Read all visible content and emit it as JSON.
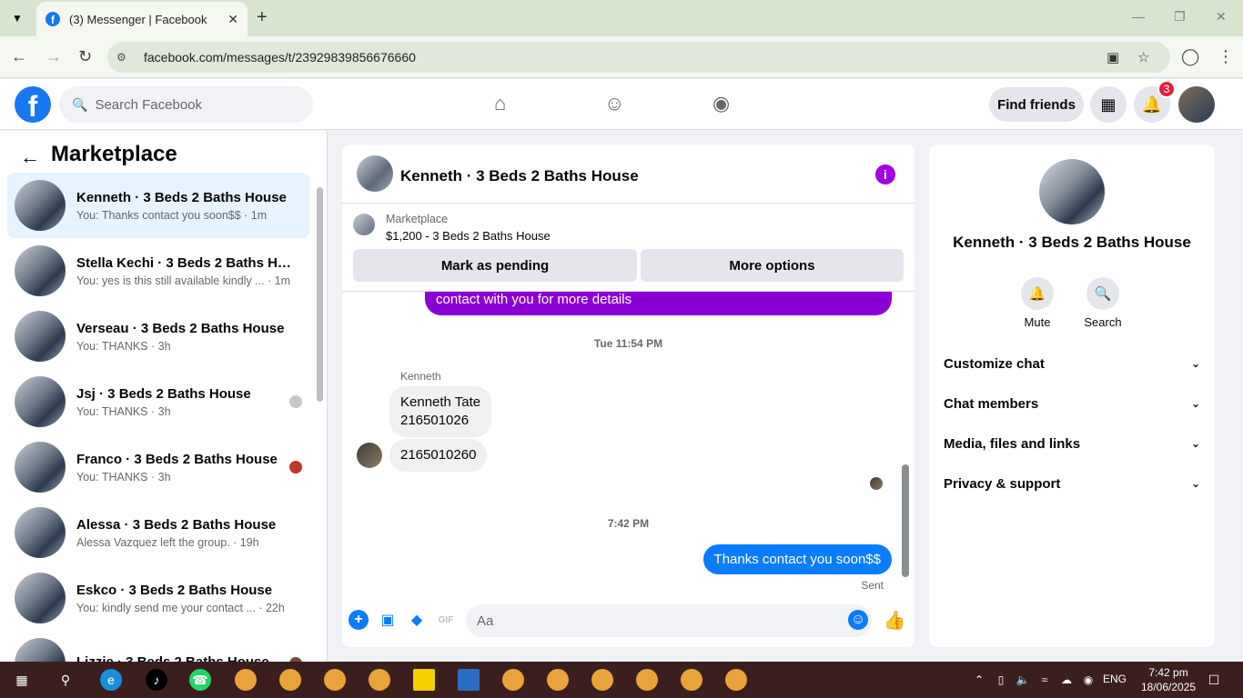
{
  "browser": {
    "tab_title": "(3) Messenger | Facebook",
    "url": "facebook.com/messages/t/23929839856676660",
    "colors": {
      "tabbar": "#d8e4d0",
      "active_tab": "#f4f8f1"
    }
  },
  "fb_header": {
    "search_placeholder": "Search Facebook",
    "find_friends": "Find friends",
    "notification_count": "3",
    "brand_color": "#1877f2"
  },
  "sidebar": {
    "title": "Marketplace",
    "conversations": [
      {
        "name": "Kenneth · 3 Beds 2 Baths House",
        "preview": "You: Thanks contact you soon$$ · 1m",
        "active": true
      },
      {
        "name": "Stella Kechi · 3 Beds 2 Baths Ho...",
        "preview": "You: yes is this still available kindly ... · 1m"
      },
      {
        "name": "Verseau · 3 Beds 2 Baths House",
        "preview": "You: THANKS · 3h"
      },
      {
        "name": "Jsj · 3 Beds 2 Baths House",
        "preview": "You: THANKS · 3h"
      },
      {
        "name": "Franco · 3 Beds 2 Baths House",
        "preview": "You: THANKS · 3h"
      },
      {
        "name": "Alessa · 3 Beds 2 Baths House",
        "preview": "Alessa Vazquez left the group. · 19h"
      },
      {
        "name": "Eskco · 3 Beds 2 Baths House",
        "preview": "You: kindly send me your contact ... · 22h"
      },
      {
        "name": "Lizzie · 3 Beds 2 Baths House",
        "preview": ""
      }
    ]
  },
  "chat": {
    "title": "Kenneth · 3 Beds 2 Baths House",
    "marketplace_label": "Marketplace",
    "listing": "$1,200 - 3 Beds 2 Baths House",
    "mark_pending": "Mark as pending",
    "more_options": "More options",
    "msg_partial": "contact with you for more details",
    "ts1": "Tue 11:54 PM",
    "sender": "Kenneth",
    "in_msg1_line1": "Kenneth Tate",
    "in_msg1_line2": "216501026",
    "in_msg2": "2165010260",
    "ts2": "7:42 PM",
    "out_msg": "Thanks contact you soon$$",
    "sent_label": "Sent",
    "composer_placeholder": "Aa",
    "accent": "#8a00d4",
    "bubble_blue": "#0a7cff"
  },
  "info_panel": {
    "name": "Kenneth · 3 Beds 2 Baths House",
    "mute": "Mute",
    "search": "Search",
    "sections": [
      "Customize chat",
      "Chat members",
      "Media, files and links",
      "Privacy & support"
    ]
  },
  "taskbar": {
    "lang": "ENG",
    "time": "7:42 pm",
    "date": "18/06/2025"
  }
}
